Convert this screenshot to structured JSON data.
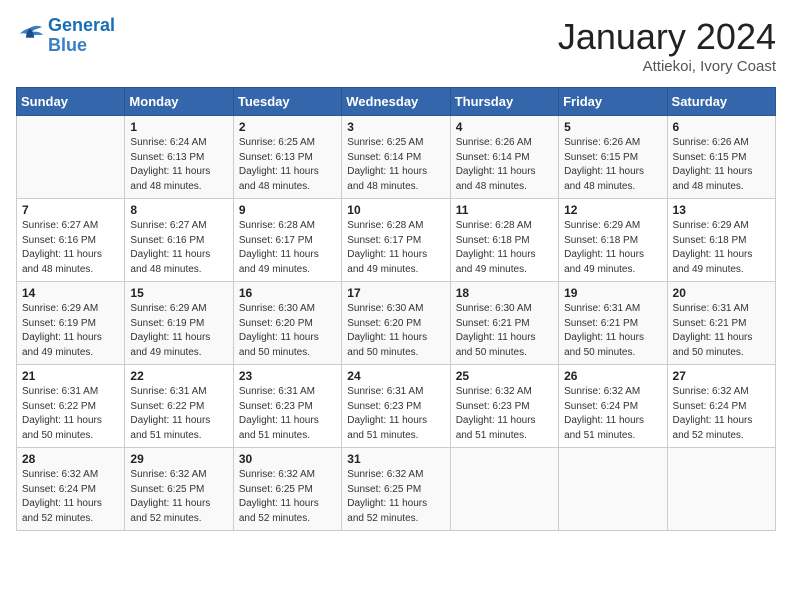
{
  "logo": {
    "line1": "General",
    "line2": "Blue"
  },
  "title": "January 2024",
  "location": "Attiekoi, Ivory Coast",
  "days_header": [
    "Sunday",
    "Monday",
    "Tuesday",
    "Wednesday",
    "Thursday",
    "Friday",
    "Saturday"
  ],
  "weeks": [
    [
      {
        "day": "",
        "info": ""
      },
      {
        "day": "1",
        "info": "Sunrise: 6:24 AM\nSunset: 6:13 PM\nDaylight: 11 hours\nand 48 minutes."
      },
      {
        "day": "2",
        "info": "Sunrise: 6:25 AM\nSunset: 6:13 PM\nDaylight: 11 hours\nand 48 minutes."
      },
      {
        "day": "3",
        "info": "Sunrise: 6:25 AM\nSunset: 6:14 PM\nDaylight: 11 hours\nand 48 minutes."
      },
      {
        "day": "4",
        "info": "Sunrise: 6:26 AM\nSunset: 6:14 PM\nDaylight: 11 hours\nand 48 minutes."
      },
      {
        "day": "5",
        "info": "Sunrise: 6:26 AM\nSunset: 6:15 PM\nDaylight: 11 hours\nand 48 minutes."
      },
      {
        "day": "6",
        "info": "Sunrise: 6:26 AM\nSunset: 6:15 PM\nDaylight: 11 hours\nand 48 minutes."
      }
    ],
    [
      {
        "day": "7",
        "info": "Sunrise: 6:27 AM\nSunset: 6:16 PM\nDaylight: 11 hours\nand 48 minutes."
      },
      {
        "day": "8",
        "info": "Sunrise: 6:27 AM\nSunset: 6:16 PM\nDaylight: 11 hours\nand 48 minutes."
      },
      {
        "day": "9",
        "info": "Sunrise: 6:28 AM\nSunset: 6:17 PM\nDaylight: 11 hours\nand 49 minutes."
      },
      {
        "day": "10",
        "info": "Sunrise: 6:28 AM\nSunset: 6:17 PM\nDaylight: 11 hours\nand 49 minutes."
      },
      {
        "day": "11",
        "info": "Sunrise: 6:28 AM\nSunset: 6:18 PM\nDaylight: 11 hours\nand 49 minutes."
      },
      {
        "day": "12",
        "info": "Sunrise: 6:29 AM\nSunset: 6:18 PM\nDaylight: 11 hours\nand 49 minutes."
      },
      {
        "day": "13",
        "info": "Sunrise: 6:29 AM\nSunset: 6:18 PM\nDaylight: 11 hours\nand 49 minutes."
      }
    ],
    [
      {
        "day": "14",
        "info": "Sunrise: 6:29 AM\nSunset: 6:19 PM\nDaylight: 11 hours\nand 49 minutes."
      },
      {
        "day": "15",
        "info": "Sunrise: 6:29 AM\nSunset: 6:19 PM\nDaylight: 11 hours\nand 49 minutes."
      },
      {
        "day": "16",
        "info": "Sunrise: 6:30 AM\nSunset: 6:20 PM\nDaylight: 11 hours\nand 50 minutes."
      },
      {
        "day": "17",
        "info": "Sunrise: 6:30 AM\nSunset: 6:20 PM\nDaylight: 11 hours\nand 50 minutes."
      },
      {
        "day": "18",
        "info": "Sunrise: 6:30 AM\nSunset: 6:21 PM\nDaylight: 11 hours\nand 50 minutes."
      },
      {
        "day": "19",
        "info": "Sunrise: 6:31 AM\nSunset: 6:21 PM\nDaylight: 11 hours\nand 50 minutes."
      },
      {
        "day": "20",
        "info": "Sunrise: 6:31 AM\nSunset: 6:21 PM\nDaylight: 11 hours\nand 50 minutes."
      }
    ],
    [
      {
        "day": "21",
        "info": "Sunrise: 6:31 AM\nSunset: 6:22 PM\nDaylight: 11 hours\nand 50 minutes."
      },
      {
        "day": "22",
        "info": "Sunrise: 6:31 AM\nSunset: 6:22 PM\nDaylight: 11 hours\nand 51 minutes."
      },
      {
        "day": "23",
        "info": "Sunrise: 6:31 AM\nSunset: 6:23 PM\nDaylight: 11 hours\nand 51 minutes."
      },
      {
        "day": "24",
        "info": "Sunrise: 6:31 AM\nSunset: 6:23 PM\nDaylight: 11 hours\nand 51 minutes."
      },
      {
        "day": "25",
        "info": "Sunrise: 6:32 AM\nSunset: 6:23 PM\nDaylight: 11 hours\nand 51 minutes."
      },
      {
        "day": "26",
        "info": "Sunrise: 6:32 AM\nSunset: 6:24 PM\nDaylight: 11 hours\nand 51 minutes."
      },
      {
        "day": "27",
        "info": "Sunrise: 6:32 AM\nSunset: 6:24 PM\nDaylight: 11 hours\nand 52 minutes."
      }
    ],
    [
      {
        "day": "28",
        "info": "Sunrise: 6:32 AM\nSunset: 6:24 PM\nDaylight: 11 hours\nand 52 minutes."
      },
      {
        "day": "29",
        "info": "Sunrise: 6:32 AM\nSunset: 6:25 PM\nDaylight: 11 hours\nand 52 minutes."
      },
      {
        "day": "30",
        "info": "Sunrise: 6:32 AM\nSunset: 6:25 PM\nDaylight: 11 hours\nand 52 minutes."
      },
      {
        "day": "31",
        "info": "Sunrise: 6:32 AM\nSunset: 6:25 PM\nDaylight: 11 hours\nand 52 minutes."
      },
      {
        "day": "",
        "info": ""
      },
      {
        "day": "",
        "info": ""
      },
      {
        "day": "",
        "info": ""
      }
    ]
  ]
}
